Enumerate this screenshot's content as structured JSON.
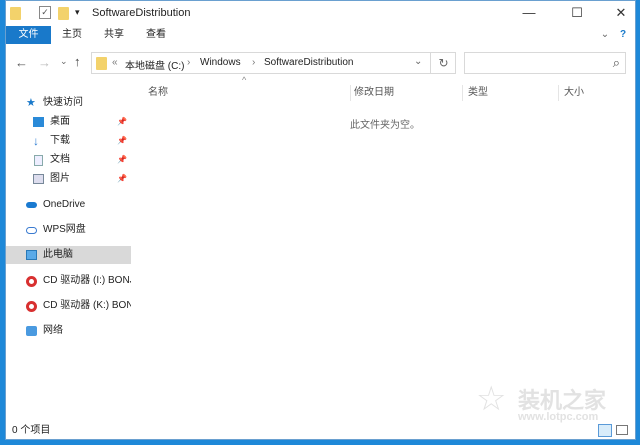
{
  "window": {
    "title": "SoftwareDistribution",
    "minimize": "—",
    "maximize": "☐",
    "close": "✕"
  },
  "ribbon": {
    "tabs": [
      "文件",
      "主页",
      "共享",
      "查看"
    ],
    "expand": "⌄",
    "help": "?"
  },
  "address": {
    "back": "←",
    "forward": "→",
    "recent": "⌄",
    "up": "↑",
    "overflow": "«",
    "crumbs": [
      "本地磁盘 (C:)",
      "Windows",
      "SoftwareDistribution"
    ],
    "sep": "›",
    "dropdown": "⌄",
    "refresh": "↻",
    "search_placeholder": "",
    "search_icon": "⌕"
  },
  "nav": {
    "quick_access": "快速访问",
    "quick_items": [
      {
        "label": "桌面"
      },
      {
        "label": "下载"
      },
      {
        "label": "文档"
      },
      {
        "label": "图片"
      }
    ],
    "pin": "📌",
    "onedrive": "OneDrive",
    "wps": "WPS网盘",
    "this_pc": "此电脑",
    "cd1": "CD 驱动器 (I:) BONJ",
    "cd2": "CD 驱动器 (K:) BON",
    "network": "网络"
  },
  "columns": [
    "名称",
    "修改日期",
    "类型",
    "大小"
  ],
  "sort_indicator": "^",
  "empty_message": "此文件夹为空。",
  "status": {
    "count": "0 个项目"
  },
  "watermark": {
    "text": "装机之家",
    "url": "www.lotpc.com"
  },
  "colors": {
    "accent": "#1979ca",
    "selected": "#d9d9d9"
  }
}
